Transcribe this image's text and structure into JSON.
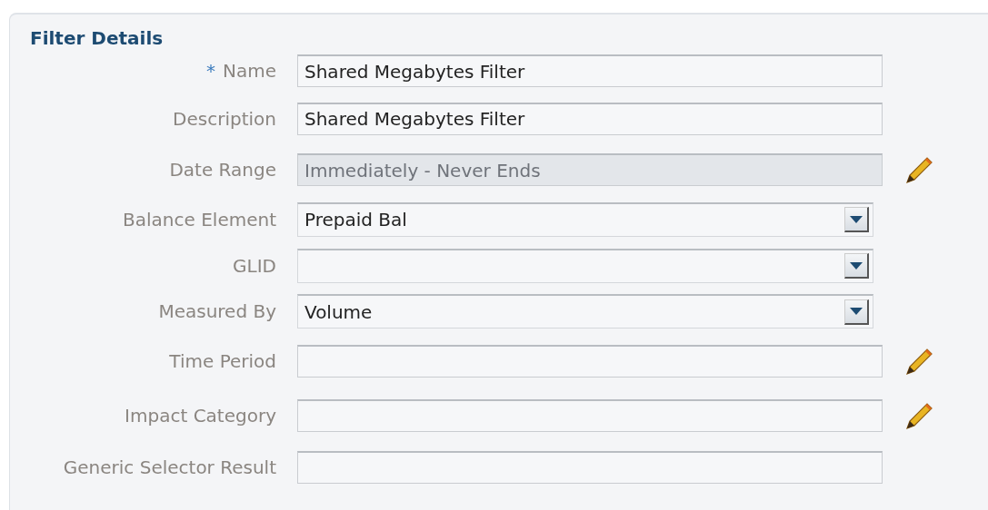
{
  "panel": {
    "title": "Filter Details"
  },
  "fields": [
    {
      "label": "Name",
      "required": true,
      "kind": "text",
      "value": "Shared Megabytes Filter",
      "editable": false
    },
    {
      "label": "Description",
      "required": false,
      "kind": "text",
      "value": "Shared Megabytes Filter",
      "editable": false
    },
    {
      "label": "Date Range",
      "required": false,
      "kind": "readonly",
      "value": "Immediately - Never Ends",
      "editable": true
    },
    {
      "label": "Balance Element",
      "required": false,
      "kind": "select",
      "value": "Prepaid Bal",
      "editable": false
    },
    {
      "label": "GLID",
      "required": false,
      "kind": "select",
      "editable": false
    },
    {
      "label": "Measured By",
      "required": false,
      "kind": "select",
      "value": "Volume",
      "editable": false
    },
    {
      "label": "Time Period",
      "required": false,
      "kind": "text",
      "editable": true
    },
    {
      "label": "Impact Category",
      "required": false,
      "kind": "text",
      "editable": true
    },
    {
      "label": "Generic Selector Result",
      "required": false,
      "kind": "text",
      "editable": false
    }
  ],
  "required_mark": "*"
}
